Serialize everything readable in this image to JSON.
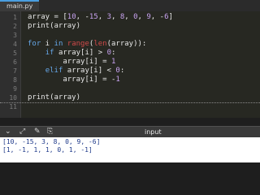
{
  "tab": {
    "filename": "main.py"
  },
  "editor": {
    "line_numbers": [
      "1",
      "2",
      "3",
      "4",
      "5",
      "6",
      "7",
      "8",
      "9",
      "10",
      "11"
    ],
    "lines": [
      [
        {
          "t": "array = [",
          "c": "p"
        },
        {
          "t": "10",
          "c": "num"
        },
        {
          "t": ", -",
          "c": "p"
        },
        {
          "t": "15",
          "c": "num"
        },
        {
          "t": ", ",
          "c": "p"
        },
        {
          "t": "3",
          "c": "num"
        },
        {
          "t": ", ",
          "c": "p"
        },
        {
          "t": "8",
          "c": "num"
        },
        {
          "t": ", ",
          "c": "p"
        },
        {
          "t": "0",
          "c": "num"
        },
        {
          "t": ", ",
          "c": "p"
        },
        {
          "t": "9",
          "c": "num"
        },
        {
          "t": ", -",
          "c": "p"
        },
        {
          "t": "6",
          "c": "num"
        },
        {
          "t": "]",
          "c": "p"
        }
      ],
      [
        {
          "t": "print(array)",
          "c": "p"
        }
      ],
      [],
      [
        {
          "t": "for",
          "c": "kw"
        },
        {
          "t": " i ",
          "c": "p"
        },
        {
          "t": "in",
          "c": "kw"
        },
        {
          "t": " ",
          "c": "p"
        },
        {
          "t": "range",
          "c": "fn"
        },
        {
          "t": "(",
          "c": "p"
        },
        {
          "t": "len",
          "c": "fn"
        },
        {
          "t": "(array)):",
          "c": "p"
        }
      ],
      [
        {
          "t": "    ",
          "c": "p"
        },
        {
          "t": "if",
          "c": "kw"
        },
        {
          "t": " array[i] > ",
          "c": "p"
        },
        {
          "t": "0",
          "c": "num"
        },
        {
          "t": ":",
          "c": "p"
        }
      ],
      [
        {
          "t": "        array[i] = ",
          "c": "p"
        },
        {
          "t": "1",
          "c": "num"
        }
      ],
      [
        {
          "t": "    ",
          "c": "p"
        },
        {
          "t": "elif",
          "c": "kw"
        },
        {
          "t": " array[i] < ",
          "c": "p"
        },
        {
          "t": "0",
          "c": "num"
        },
        {
          "t": ":",
          "c": "p"
        }
      ],
      [
        {
          "t": "        array[i] = -",
          "c": "p"
        },
        {
          "t": "1",
          "c": "num"
        }
      ],
      [],
      [
        {
          "t": "print(array)",
          "c": "p"
        }
      ],
      []
    ]
  },
  "console": {
    "controls": [
      "⌄",
      "⤢",
      "✎",
      "⎘"
    ],
    "label": "input",
    "output": [
      "[10, -15, 3, 8, 0, 9, -6]",
      "[1, -1, 1, 1, 0, 1, -1]"
    ]
  },
  "colors": {
    "keyword": "#66a7e8",
    "builtin": "#d04a4a",
    "number": "#c7a2f0",
    "output_text": "#1f3a8a"
  }
}
